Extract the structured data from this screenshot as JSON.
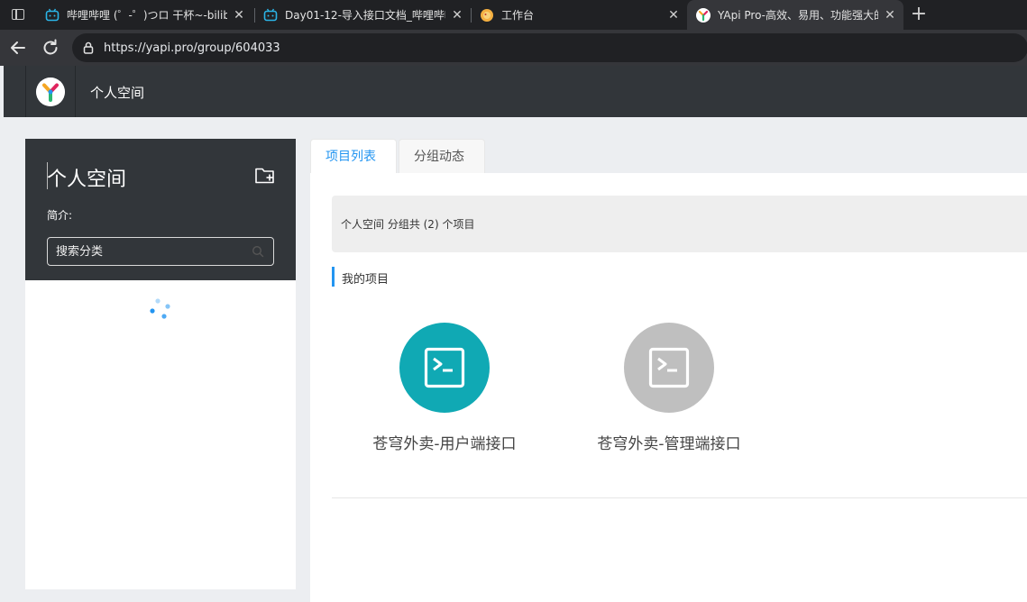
{
  "browser": {
    "tabs": [
      {
        "title": "哔哩哔哩 (゜-゜)つロ 干杯~-bilibi",
        "favicon": "bilibili-icon",
        "active": false
      },
      {
        "title": "Day01-12-导入接口文档_哔哩哔哩",
        "favicon": "bilibili-icon",
        "active": false
      },
      {
        "title": "工作台",
        "favicon": "workbench-icon",
        "active": false
      },
      {
        "title": "YApi Pro-高效、易用、功能强大的",
        "favicon": "yapi-icon",
        "active": true
      }
    ],
    "url": "https://yapi.pro/group/604033"
  },
  "header": {
    "title": "个人空间"
  },
  "sidebar": {
    "group_name": "个人空间",
    "intro_label": "简介:",
    "search_placeholder": "搜索分类"
  },
  "content": {
    "tabs": [
      {
        "label": "项目列表",
        "active": true
      },
      {
        "label": "分组动态",
        "active": false
      }
    ],
    "summary": "个人空间 分组共 (2) 个项目",
    "section_title": "我的项目",
    "projects": [
      {
        "name": "苍穹外卖-用户端接口",
        "color": "#10a9b4"
      },
      {
        "name": "苍穹外卖-管理端接口",
        "color": "#bfbfbf"
      }
    ]
  },
  "colors": {
    "accent": "#2395f1",
    "header_bg": "#32363a"
  }
}
